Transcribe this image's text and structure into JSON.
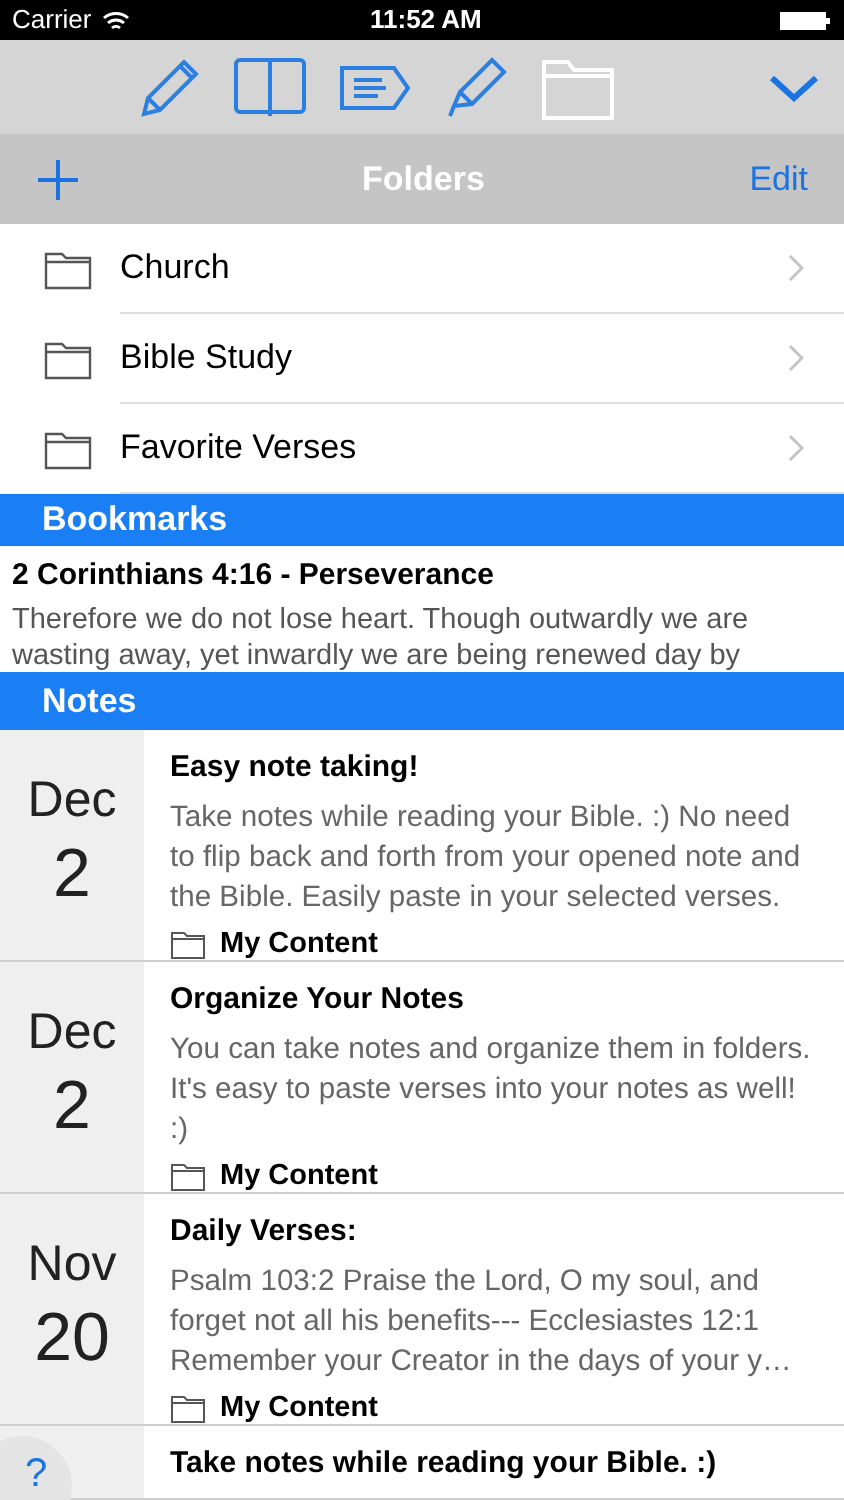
{
  "status_bar": {
    "carrier": "Carrier",
    "time": "11:52 AM"
  },
  "toolbar": {
    "tools": [
      {
        "kind": "pencil",
        "selected": false
      },
      {
        "kind": "book",
        "selected": false
      },
      {
        "kind": "tag",
        "selected": false
      },
      {
        "kind": "highlighter",
        "selected": false
      },
      {
        "kind": "folder",
        "selected": true
      }
    ]
  },
  "folders_bar": {
    "title": "Folders",
    "edit": "Edit"
  },
  "folders": [
    {
      "name": "Church"
    },
    {
      "name": "Bible Study"
    },
    {
      "name": "Favorite Verses"
    }
  ],
  "bookmarks": {
    "header": "Bookmarks",
    "items": [
      {
        "title": "2 Corinthians 4:16 - Perseverance",
        "text": "Therefore we do not lose heart. Though outwardly we are wasting away, yet inwardly we are being renewed day by"
      }
    ]
  },
  "notes": {
    "header": "Notes",
    "items": [
      {
        "month": "Dec",
        "day": "2",
        "title": "Easy note taking!",
        "text": "Take notes while reading your Bible. :)   No need to flip back and forth from your opened note and the Bible. Easily paste in your selected verses.",
        "folder": "My Content"
      },
      {
        "month": "Dec",
        "day": "2",
        "title": "Organize Your Notes",
        "text": "You can take notes and organize them in folders. It's easy to paste verses into your notes as well! :)",
        "folder": "My Content"
      },
      {
        "month": "Nov",
        "day": "20",
        "title": "Daily Verses:",
        "text": "Psalm 103:2 Praise the Lord, O my soul, and forget not all his benefits---  Ecclesiastes 12:1 Remember your Creator in the days of your y…",
        "folder": "My Content"
      },
      {
        "title": "Take notes while reading your Bible. :)"
      }
    ]
  },
  "help": {
    "label": "?"
  }
}
